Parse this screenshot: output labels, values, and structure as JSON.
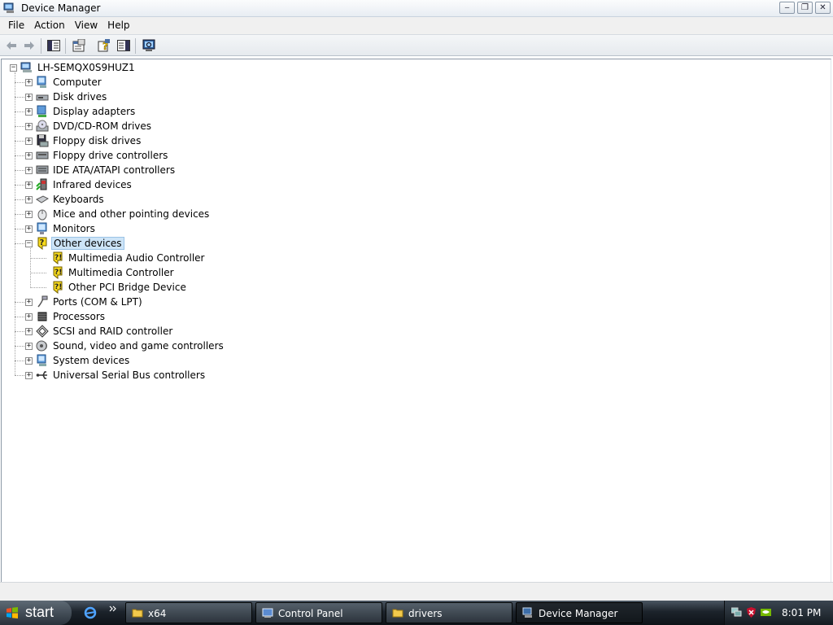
{
  "window": {
    "title": "Device Manager",
    "controls": {
      "minimize": "‒",
      "restore": "❐",
      "close": "✕"
    }
  },
  "menu": [
    "File",
    "Action",
    "View",
    "Help"
  ],
  "toolbar": {
    "buttons": [
      "back-icon",
      "forward-icon",
      "show-hide-tree-icon",
      "properties-icon",
      "help-icon",
      "show-hide-action-pane-icon",
      "scan-hardware-icon"
    ]
  },
  "tree": {
    "root": "LH-SEMQX0S9HUZ1",
    "categories": [
      {
        "label": "Computer",
        "icon": "computer-icon",
        "expanded": false
      },
      {
        "label": "Disk drives",
        "icon": "disk-drive-icon",
        "expanded": false
      },
      {
        "label": "Display adapters",
        "icon": "display-adapter-icon",
        "expanded": false
      },
      {
        "label": "DVD/CD-ROM drives",
        "icon": "dvd-drive-icon",
        "expanded": false
      },
      {
        "label": "Floppy disk drives",
        "icon": "floppy-disk-icon",
        "expanded": false
      },
      {
        "label": "Floppy drive controllers",
        "icon": "floppy-controller-icon",
        "expanded": false
      },
      {
        "label": "IDE ATA/ATAPI controllers",
        "icon": "ide-controller-icon",
        "expanded": false
      },
      {
        "label": "Infrared devices",
        "icon": "infrared-icon",
        "expanded": false
      },
      {
        "label": "Keyboards",
        "icon": "keyboard-icon",
        "expanded": false
      },
      {
        "label": "Mice and other pointing devices",
        "icon": "mouse-icon",
        "expanded": false
      },
      {
        "label": "Monitors",
        "icon": "monitor-icon",
        "expanded": false
      },
      {
        "label": "Other devices",
        "icon": "unknown-device-icon",
        "expanded": true,
        "selected": true,
        "children": [
          "Multimedia Audio Controller",
          "Multimedia Controller",
          "Other PCI Bridge Device"
        ]
      },
      {
        "label": "Ports (COM & LPT)",
        "icon": "port-icon",
        "expanded": false
      },
      {
        "label": "Processors",
        "icon": "processor-icon",
        "expanded": false
      },
      {
        "label": "SCSI and RAID controller",
        "icon": "scsi-icon",
        "expanded": false
      },
      {
        "label": "Sound, video and game controllers",
        "icon": "sound-icon",
        "expanded": false
      },
      {
        "label": "System devices",
        "icon": "system-devices-icon",
        "expanded": false
      },
      {
        "label": "Universal Serial Bus controllers",
        "icon": "usb-icon",
        "expanded": false
      }
    ]
  },
  "taskbar": {
    "start_label": "start",
    "tasks": [
      {
        "label": "x64",
        "icon": "folder-icon",
        "active": false
      },
      {
        "label": "Control Panel",
        "icon": "control-panel-icon",
        "active": false
      },
      {
        "label": "drivers",
        "icon": "folder-icon",
        "active": false
      },
      {
        "label": "Device Manager",
        "icon": "device-manager-icon",
        "active": true
      }
    ],
    "clock": "8:01 PM"
  },
  "colors": {
    "selection": "#cde4f7",
    "warning": "#f6d91c",
    "taskbar": "#1c232b"
  }
}
